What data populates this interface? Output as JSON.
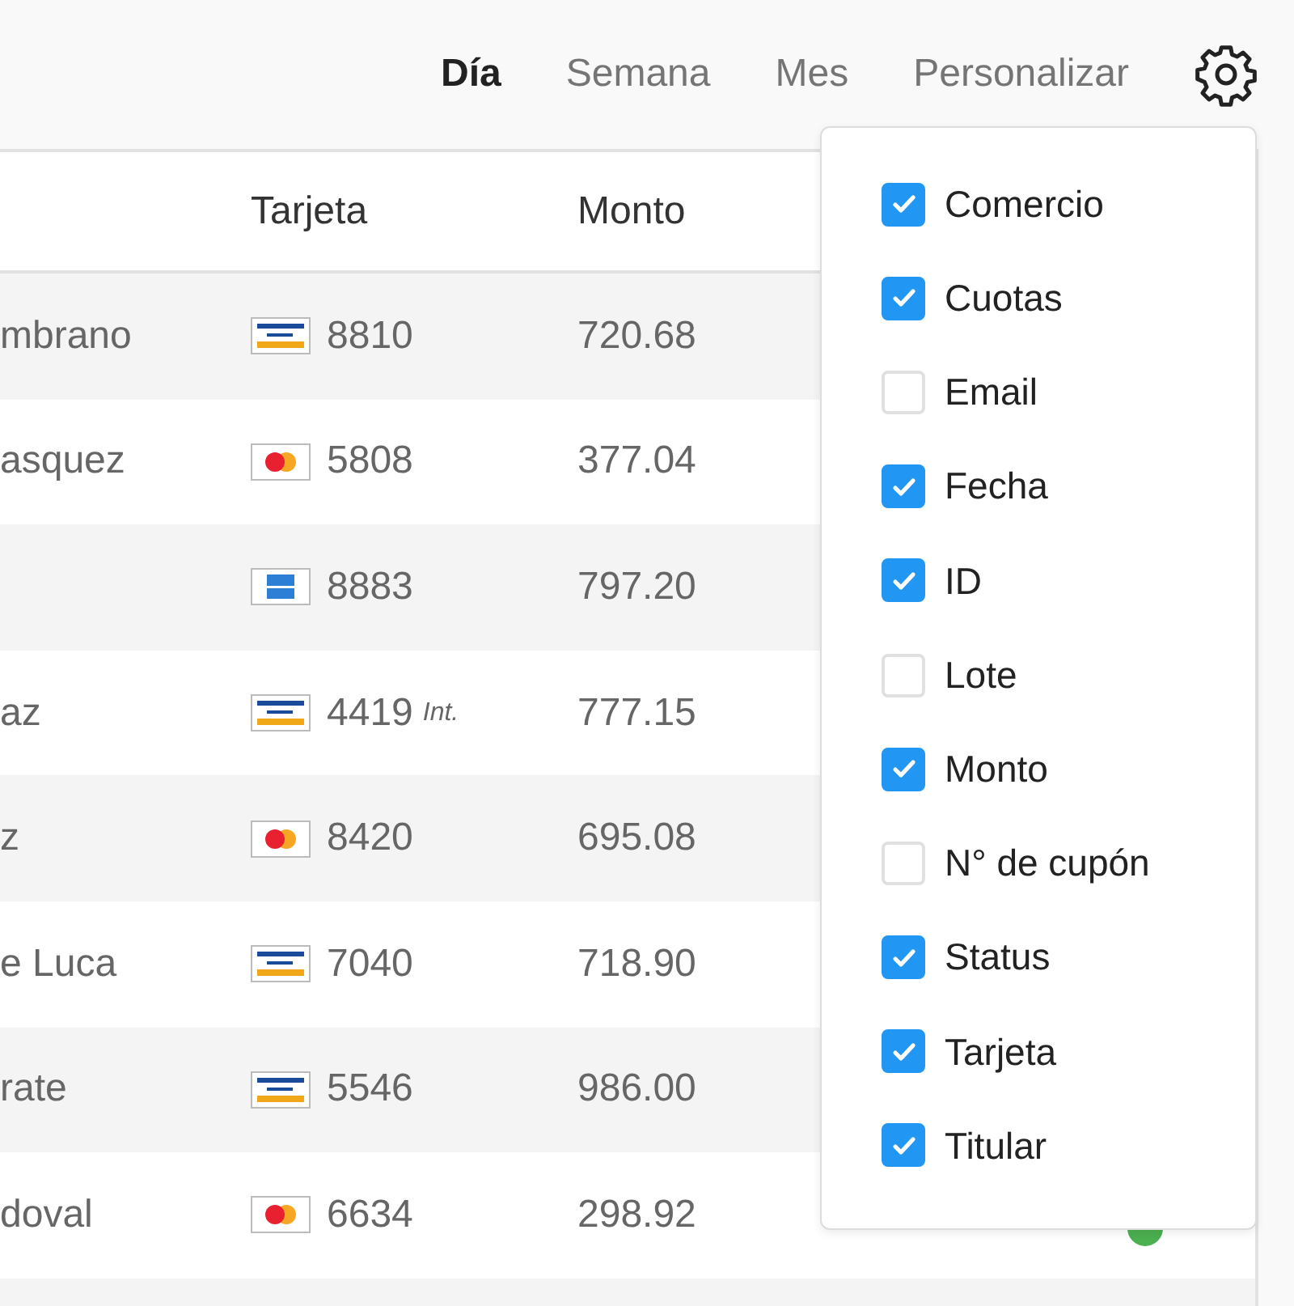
{
  "periods": [
    {
      "label": "Día",
      "selected": true
    },
    {
      "label": "Semana",
      "selected": false
    },
    {
      "label": "Mes",
      "selected": false
    },
    {
      "label": "Personalizar",
      "selected": false
    }
  ],
  "table": {
    "columns": [
      "Tarjeta",
      "Monto"
    ],
    "rows": [
      {
        "titular": "mbrano",
        "kind": "stripes",
        "card": "8810",
        "monto": "720.68"
      },
      {
        "titular": "asquez",
        "kind": "circles",
        "card": "5808",
        "monto": "377.04"
      },
      {
        "titular": "",
        "kind": "plain",
        "card": "8883",
        "monto": "797.20"
      },
      {
        "titular": "az",
        "kind": "stripes",
        "card": "4419",
        "note": "Int.",
        "monto": "777.15"
      },
      {
        "titular": "z",
        "kind": "circles",
        "card": "8420",
        "monto": "695.08"
      },
      {
        "titular": "e Luca",
        "kind": "stripes",
        "card": "7040",
        "monto": "718.90"
      },
      {
        "titular": "rate",
        "kind": "stripes",
        "card": "5546",
        "monto": "986.00"
      },
      {
        "titular": "doval",
        "kind": "circles",
        "card": "6634",
        "monto": "298.92",
        "color": "#4caf50"
      }
    ]
  },
  "column_menu": [
    {
      "label": "Comercio",
      "checked": true
    },
    {
      "label": "Cuotas",
      "checked": true
    },
    {
      "label": "Email",
      "checked": false
    },
    {
      "label": "Fecha",
      "checked": true
    },
    {
      "label": "ID",
      "checked": true
    },
    {
      "label": "Lote",
      "checked": false
    },
    {
      "label": "Monto",
      "checked": true
    },
    {
      "label": "N° de cupón",
      "checked": false
    },
    {
      "label": "Status",
      "checked": true
    },
    {
      "label": "Tarjeta",
      "checked": true
    },
    {
      "label": "Titular",
      "checked": true
    }
  ]
}
